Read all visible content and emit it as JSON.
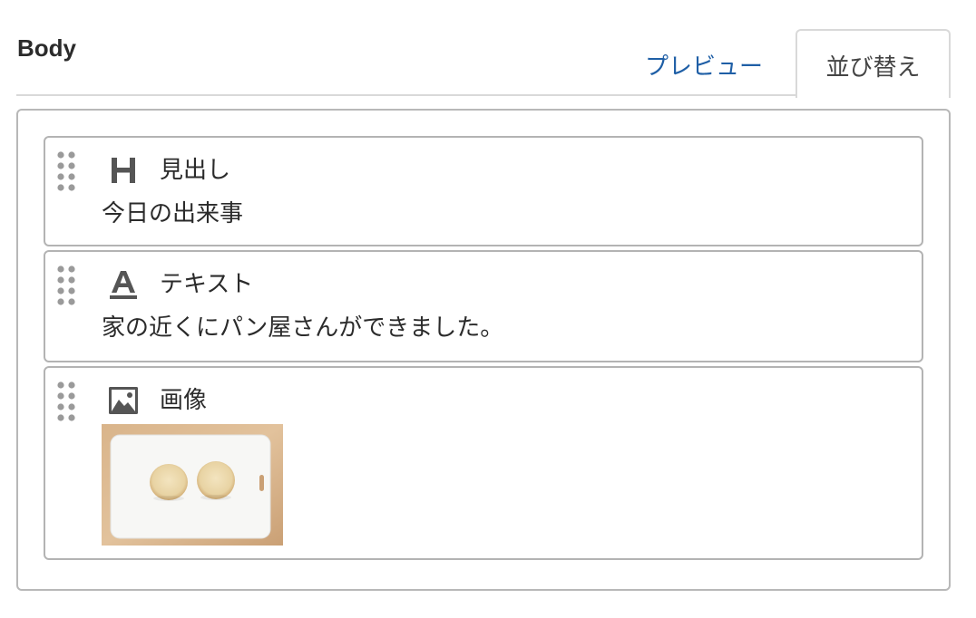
{
  "field": {
    "title": "Body"
  },
  "tabs": [
    {
      "label": "プレビュー",
      "active": false
    },
    {
      "label": "並び替え",
      "active": true
    }
  ],
  "colors": {
    "tab_link": "#1f5fa6",
    "border": "#b3b3b3",
    "icon": "#555555",
    "handle": "#9a9a9a"
  },
  "blocks": [
    {
      "type_icon": "heading-icon",
      "type_label": "見出し",
      "content": "今日の出来事"
    },
    {
      "type_icon": "text-icon",
      "type_label": "テキスト",
      "content": "家の近くにパン屋さんができました。"
    },
    {
      "type_icon": "image-icon",
      "type_label": "画像",
      "image": "bread-on-cutting-board"
    }
  ]
}
